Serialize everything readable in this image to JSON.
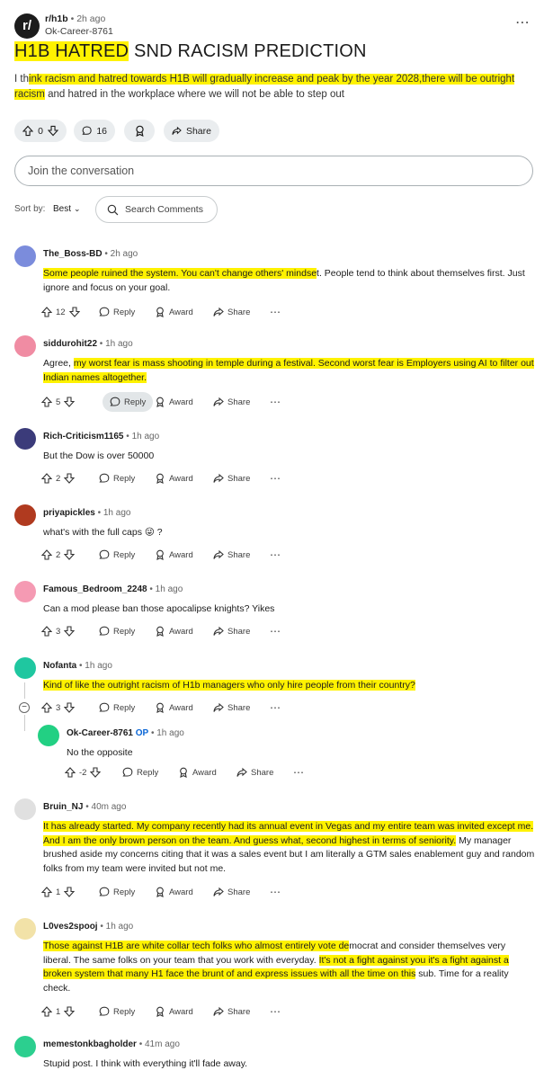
{
  "post": {
    "subreddit": "r/h1b",
    "time": "2h ago",
    "author": "Ok-Career-8761",
    "title_highlighted": "H1B HATRED",
    "title_rest": " SND RACISM PREDICTION",
    "body_pre": "I th",
    "body_highlight": "ink racism and hatred towards H1B will gradually increase and peak by the year 2028,there will be outright racism",
    "body_rest": " and hatred in the workplace where we will not be able to step out",
    "votes": "0",
    "comments": "16",
    "share_label": "Share",
    "join_placeholder": "Join the conversation",
    "sort_label": "Sort by:",
    "sort_value": "Best",
    "search_label": "Search Comments"
  },
  "labels": {
    "reply": "Reply",
    "award": "Award",
    "share": "Share",
    "op": "OP"
  },
  "comments": [
    {
      "user": "The_Boss-BD",
      "time": "2h ago",
      "votes": "12",
      "text_pre": "",
      "text_hl": "Some people ruined the system. You can't change others' mindse",
      "text_post": "t. People tend to think about themselves first. Just ignore and focus on your goal."
    },
    {
      "user": "siddurohit22",
      "time": "1h ago",
      "votes": "5",
      "text_pre": "Agree, ",
      "text_hl": "my worst fear is mass shooting in temple during a festival. Second worst fear is Employers using AI to filter out Indian names altogether.",
      "text_post": ""
    },
    {
      "user": "Rich-Criticism1165",
      "time": "1h ago",
      "votes": "2",
      "text_pre": "But the Dow is over 50000",
      "text_hl": "",
      "text_post": ""
    },
    {
      "user": "priyapickles",
      "time": "1h ago",
      "votes": "2",
      "text_pre": "what's with the full caps 😜 ?",
      "text_hl": "",
      "text_post": ""
    },
    {
      "user": "Famous_Bedroom_2248",
      "time": "1h ago",
      "votes": "3",
      "text_pre": "Can a mod please ban those apocalipse knights? Yikes",
      "text_hl": "",
      "text_post": ""
    },
    {
      "user": "Nofanta",
      "time": "1h ago",
      "votes": "3",
      "text_pre": "",
      "text_hl": "Kind of like the outright racism of H1b managers who only hire people from their country?",
      "text_post": ""
    },
    {
      "user": "Ok-Career-8761",
      "time": "1h ago",
      "votes": "-2",
      "text_pre": "No the opposite",
      "text_hl": "",
      "text_post": ""
    },
    {
      "user": "Bruin_NJ",
      "time": "40m ago",
      "votes": "1",
      "text_pre": "",
      "text_hl": "It has already started. My company recently had its annual event in Vegas and my entire team was invited except me. And I am the only brown person on the team. And guess what, second highest in terms of seniority.",
      "text_post": " My manager brushed aside my concerns citing that it was a sales event but I am literally a GTM sales enablement guy and random folks from my team were invited but not me."
    },
    {
      "user": "L0ves2spooj",
      "time": "1h ago",
      "votes": "1",
      "text_pre": "",
      "text_hl": "Those against H1B are white collar tech folks who almost entirely vote de",
      "text_post": "mocrat and consider themselves very liberal. The same folks on your team that you work with everyday. ",
      "text_hl2": "It's not a fight against you it's a fight against a broken system that many H1 face the brunt of and express issues with all the time on this",
      "text_post2": " sub. Time for a reality check."
    },
    {
      "user": "memestonkbagholder",
      "time": "41m ago",
      "votes": "",
      "text_pre": "Stupid post. I think with everything it'll fade away.",
      "text_hl": "",
      "text_post": ""
    }
  ],
  "colors": {
    "highlight": "#fff200",
    "op_badge": "#0a66d6",
    "pill_bg": "#eaedef"
  }
}
